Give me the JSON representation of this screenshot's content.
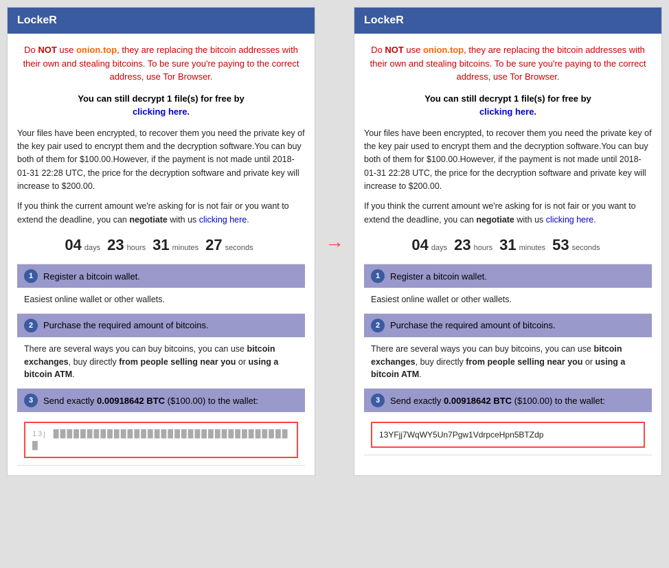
{
  "panels": [
    {
      "id": "left",
      "header": "LockeR",
      "warning": {
        "prefix": "Do ",
        "not": "NOT",
        "postfix": " use ",
        "site": "onion.top",
        "rest": ", they are replacing the bitcoin addresses with their own and stealing bitcoins. To be sure you're paying to the correct address, use Tor Browser."
      },
      "free_decrypt": "You can still decrypt 1 file(s) for free by clicking here.",
      "info1": "Your files have been encrypted, to recover them you need the private key of the key pair used to encrypt them and the decryption software.You can buy both of them for $100.00.However, if the payment is not made until 2018-01-31 22:28 UTC, the price for the decryption software and private key will increase to $200.00.",
      "info2": "If you think the current amount we're asking for is not fair or you want to extend the deadline, you can negotiate with us clicking here.",
      "countdown": {
        "days_num": "04",
        "days_label": "days",
        "hours_num": "23",
        "hours_label": "hours",
        "minutes_num": "31",
        "minutes_label": "minutes",
        "seconds_num": "27",
        "seconds_label": "seconds"
      },
      "steps": [
        {
          "number": "1",
          "header": "Register a bitcoin wallet.",
          "content": "Easiest online wallet or other wallets."
        },
        {
          "number": "2",
          "header": "Purchase the required amount of bitcoins.",
          "content": "There are several ways you can buy bitcoins, you can use bitcoin exchanges, buy directly from people selling near you or using a bitcoin ATM."
        },
        {
          "number": "3",
          "header": "Send exactly 0.00918642 BTC ($100.00) to the wallet:",
          "wallet": "13j████████████████████████████████████",
          "is_blurred": true
        }
      ]
    },
    {
      "id": "right",
      "header": "LockeR",
      "warning": {
        "prefix": "Do ",
        "not": "NOT",
        "postfix": " use ",
        "site": "onion.top",
        "rest": ", they are replacing the bitcoin addresses with their own and stealing bitcoins. To be sure you're paying to the correct address, use Tor Browser."
      },
      "free_decrypt": "You can still decrypt 1 file(s) for free by clicking here.",
      "info1": "Your files have been encrypted, to recover them you need the private key of the key pair used to encrypt them and the decryption software.You can buy both of them for $100.00.However, if the payment is not made until 2018-01-31 22:28 UTC, the price for the decryption software and private key will increase to $200.00.",
      "info2": "If you think the current amount we're asking for is not fair or you want to extend the deadline, you can negotiate with us clicking here.",
      "countdown": {
        "days_num": "04",
        "days_label": "days",
        "hours_num": "23",
        "hours_label": "hours",
        "minutes_num": "31",
        "minutes_label": "minutes",
        "seconds_num": "53",
        "seconds_label": "seconds"
      },
      "steps": [
        {
          "number": "1",
          "header": "Register a bitcoin wallet.",
          "content": "Easiest online wallet or other wallets."
        },
        {
          "number": "2",
          "header": "Purchase the required amount of bitcoins.",
          "content": "There are several ways you can buy bitcoins, you can use bitcoin exchanges, buy directly from people selling near you or using a bitcoin ATM."
        },
        {
          "number": "3",
          "header": "Send exactly 0.00918642 BTC ($100.00) to the wallet:",
          "wallet": "13YFjj7WqWY5Un7Pgw1VdrpceHpn5BTZdp",
          "is_blurred": false
        }
      ]
    }
  ],
  "arrow_symbol": "→",
  "btc_amount": "0.00918642 BTC",
  "btc_usd": "($100.00)"
}
